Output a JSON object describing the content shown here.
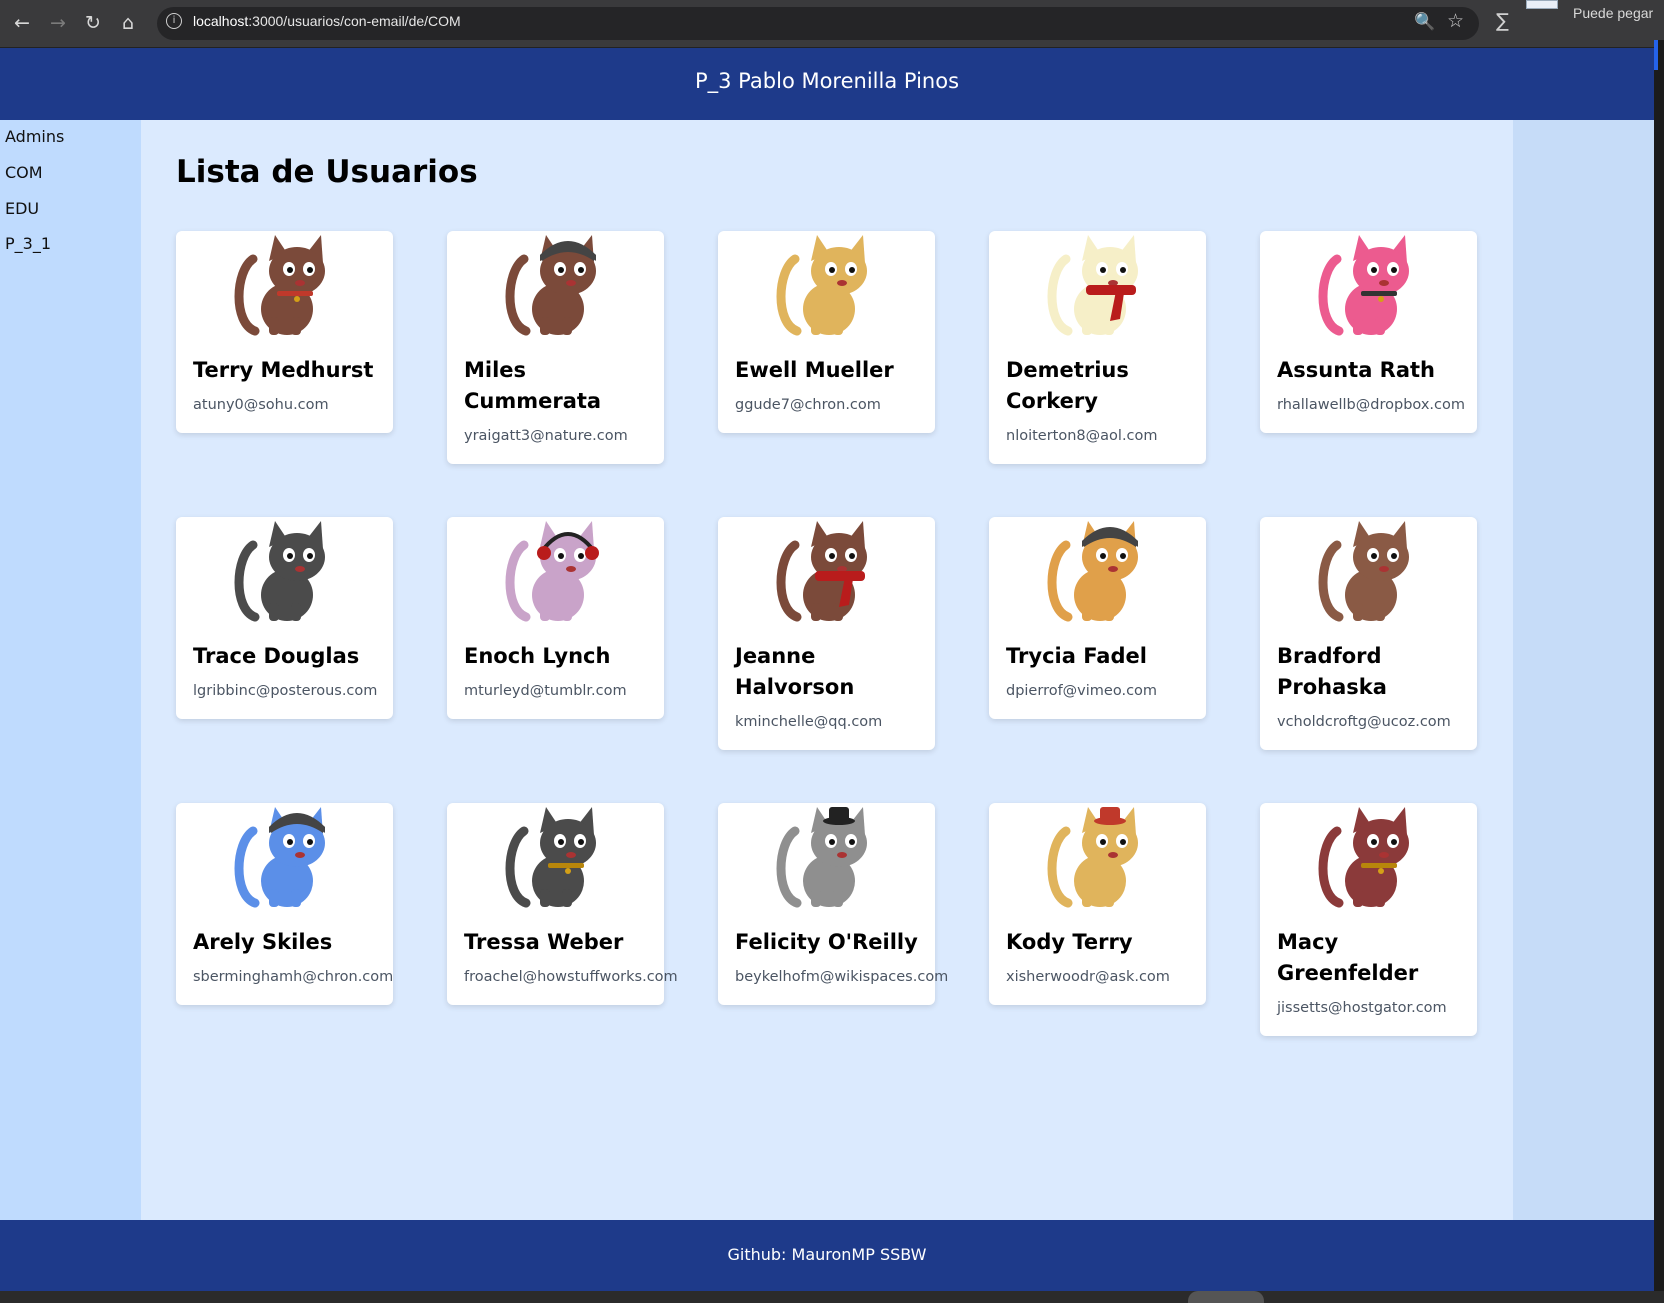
{
  "browser": {
    "url_host": "localhost",
    "url_rest": ":3000/usuarios/con-email/de/COM",
    "popup_text": "Puede pegar"
  },
  "header": {
    "title": "P_3 Pablo Morenilla Pinos"
  },
  "sidebar": {
    "items": [
      {
        "label": "Admins"
      },
      {
        "label": "COM"
      },
      {
        "label": "EDU"
      },
      {
        "label": "P_3_1"
      }
    ]
  },
  "main": {
    "title": "Lista de Usuarios",
    "users": [
      {
        "name": "Terry Medhurst",
        "email": "atuny0@sohu.com",
        "avatar": {
          "fur": "#7b4a3a",
          "accent": "#c0392b",
          "hat": "collar"
        }
      },
      {
        "name": "Miles Cummerata",
        "email": "yraigatt3@nature.com",
        "avatar": {
          "fur": "#7b4a3a",
          "accent": "#444444",
          "hat": "bandana"
        }
      },
      {
        "name": "Ewell Mueller",
        "email": "ggude7@chron.com",
        "avatar": {
          "fur": "#e0b45c",
          "accent": "#333333",
          "hat": "none"
        }
      },
      {
        "name": "Demetrius Corkery",
        "email": "nloiterton8@aol.com",
        "avatar": {
          "fur": "#f6efc8",
          "accent": "#b91c1c",
          "hat": "scarf"
        }
      },
      {
        "name": "Assunta Rath",
        "email": "rhallawellb@dropbox.com",
        "avatar": {
          "fur": "#ec5b8f",
          "accent": "#333333",
          "hat": "collar"
        }
      },
      {
        "name": "Trace Douglas",
        "email": "lgribbinc@posterous.com",
        "avatar": {
          "fur": "#4b4b4b",
          "accent": "#222222",
          "hat": "none"
        }
      },
      {
        "name": "Enoch Lynch",
        "email": "mturleyd@tumblr.com",
        "avatar": {
          "fur": "#c9a3c9",
          "accent": "#b91c1c",
          "hat": "headphones"
        }
      },
      {
        "name": "Jeanne Halvorson",
        "email": "kminchelle@qq.com",
        "avatar": {
          "fur": "#7b4a3a",
          "accent": "#b91c1c",
          "hat": "scarf"
        }
      },
      {
        "name": "Trycia Fadel",
        "email": "dpierrof@vimeo.com",
        "avatar": {
          "fur": "#e0a04a",
          "accent": "#444444",
          "hat": "bandana"
        }
      },
      {
        "name": "Bradford Prohaska",
        "email": "vcholdcroftg@ucoz.com",
        "avatar": {
          "fur": "#8a5a45",
          "accent": "#f3e2d0",
          "hat": "none"
        }
      },
      {
        "name": "Arely Skiles",
        "email": "sberminghamh@chron.com",
        "avatar": {
          "fur": "#5b8fe8",
          "accent": "#444444",
          "hat": "bandana"
        }
      },
      {
        "name": "Tressa Weber",
        "email": "froachel@howstuffworks.com",
        "avatar": {
          "fur": "#4b4b4b",
          "accent": "#b8860b",
          "hat": "collar"
        }
      },
      {
        "name": "Felicity O'Reilly",
        "email": "beykelhofm@wikispaces.com",
        "avatar": {
          "fur": "#8f8f8f",
          "accent": "#222222",
          "hat": "tophat"
        }
      },
      {
        "name": "Kody Terry",
        "email": "xisherwoodr@ask.com",
        "avatar": {
          "fur": "#e0b45c",
          "accent": "#c0392b",
          "hat": "tophat"
        }
      },
      {
        "name": "Macy Greenfelder",
        "email": "jissetts@hostgator.com",
        "avatar": {
          "fur": "#8b3a3a",
          "accent": "#b8860b",
          "hat": "collar"
        }
      }
    ]
  },
  "footer": {
    "text": "Github: MauronMP SSBW"
  }
}
